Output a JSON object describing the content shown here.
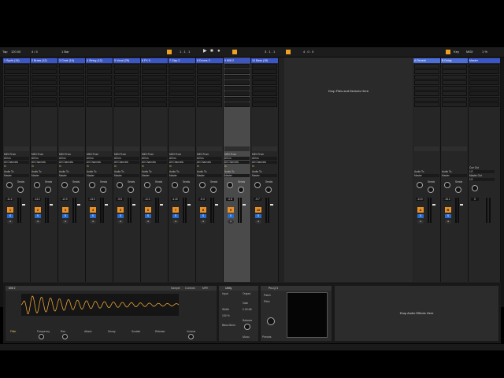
{
  "transport": {
    "tap": "Tap",
    "tempo": "120.00",
    "sig": "4 / 4",
    "quant": "1 Bar",
    "pos": "1 . 1 . 1",
    "loop_start": "3 . 1 . 1",
    "loop_len": "4 . 0 . 0",
    "key": "Key",
    "midi": "MIDI",
    "cpu": "1 %"
  },
  "tracks": [
    {
      "name": "1 Synth (15)",
      "num": "1",
      "input": "MIDI From",
      "src": "All Ins",
      "ch": "All Channels",
      "monitor": "In",
      "audio_to": "Audio To",
      "dest": "Master",
      "vol": "-11.2",
      "sel": false
    },
    {
      "name": "2 Brass (12)",
      "num": "2",
      "input": "MIDI From",
      "src": "All Ins",
      "ch": "All Channels",
      "monitor": "In",
      "audio_to": "Audio To",
      "dest": "Master",
      "vol": "-14.2",
      "sel": false
    },
    {
      "name": "3 Choir (10)",
      "num": "3",
      "input": "MIDI From",
      "src": "All Ins",
      "ch": "All Channels",
      "monitor": "In",
      "audio_to": "Audio To",
      "dest": "Master",
      "vol": "-12.9",
      "sel": false
    },
    {
      "name": "4 String (12)",
      "num": "4",
      "input": "MIDI From",
      "src": "All Ins",
      "ch": "All Channels",
      "monitor": "In",
      "audio_to": "Audio To",
      "dest": "Master",
      "vol": "-13.0",
      "sel": false
    },
    {
      "name": "5 Vocal (25)",
      "num": "5",
      "input": "MIDI From",
      "src": "All Ins",
      "ch": "All Channels",
      "monitor": "In",
      "audio_to": "Audio To",
      "dest": "Master",
      "vol": "-9.5",
      "sel": false
    },
    {
      "name": "6 FX 9",
      "num": "6",
      "input": "MIDI From",
      "src": "All Ins",
      "ch": "All Channels",
      "monitor": "In",
      "audio_to": "Audio To",
      "dest": "Master",
      "vol": "-11.0",
      "sel": false
    },
    {
      "name": "7 Clap 2",
      "num": "7",
      "input": "MIDI From",
      "src": "All Ins",
      "ch": "All Channels",
      "monitor": "In",
      "audio_to": "Audio To",
      "dest": "Master",
      "vol": "-4.40",
      "sel": false
    },
    {
      "name": "8 Drums 3",
      "num": "8",
      "input": "MIDI From",
      "src": "All Ins",
      "ch": "All Channels",
      "monitor": "In",
      "audio_to": "Audio To",
      "dest": "Master",
      "vol": "-9.4",
      "sel": false
    },
    {
      "name": "9 808 2",
      "num": "9",
      "input": "MIDI From",
      "src": "All Ins",
      "ch": "All Channels",
      "monitor": "In",
      "audio_to": "Audio To",
      "dest": "Master",
      "vol": "-0.8",
      "sel": true
    },
    {
      "name": "10 Bass (15)",
      "num": "10",
      "input": "MIDI From",
      "src": "All Ins",
      "ch": "All Channels",
      "monitor": "In",
      "audio_to": "Audio To",
      "dest": "Master",
      "vol": "-9.7",
      "sel": false
    }
  ],
  "returns": [
    {
      "name": "A Reverb",
      "num": "A",
      "audio_to": "Audio To",
      "dest": "Master",
      "vol": "-13.0"
    },
    {
      "name": "B Delay",
      "num": "B",
      "audio_to": "Audio To",
      "dest": "Master",
      "vol": "-16.2"
    }
  ],
  "master": {
    "name": "Master",
    "cue_out": "Cue Out",
    "cue_dest": "1/2",
    "master_out": "Master Out",
    "master_dest": "1/2",
    "vol": "0"
  },
  "drop_files": "Drop Files and Devices Here",
  "drop_fx": "Drop Audio Effects Here",
  "sends_label": "Sends",
  "solo": "S",
  "record": "●",
  "devices": {
    "sampler": {
      "name": "808 2",
      "tab1": "Sample",
      "tab2": "Controls",
      "tab3": "MPE",
      "filter": "Filter",
      "freq": "Frequency",
      "res": "Res",
      "attack": "Attack",
      "decay": "Decay",
      "sustain": "Sustain",
      "release": "Release",
      "volume": "Volume"
    },
    "utility": {
      "name": "Utility",
      "gain": "Gain",
      "width": "Width",
      "mono": "Mono",
      "bass_mono": "Bass Mono",
      "balance": "Balance",
      "input": "Input",
      "output": "Output",
      "gain_val": "0.00 dB",
      "width_val": "100 %"
    },
    "pad": {
      "name": "Pro-Q 3",
      "preset": "Patch",
      "dest": "Pitch",
      "sub": "Presets"
    }
  }
}
